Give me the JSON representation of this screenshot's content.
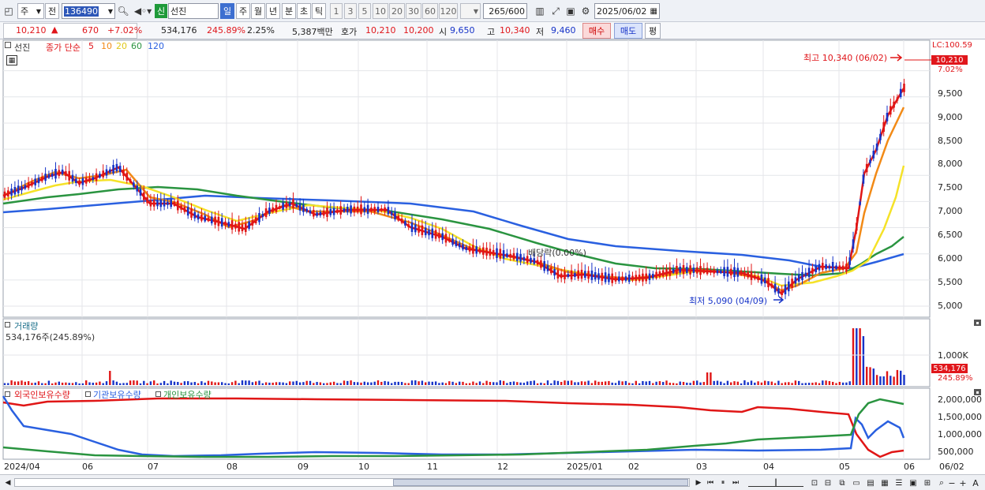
{
  "toolbar": {
    "period_select": "주",
    "prev_label": "전",
    "code": "136490",
    "sin_badge": "신",
    "stock_name": "선진",
    "timeframes": [
      "일",
      "주",
      "월",
      "년",
      "분",
      "초",
      "틱"
    ],
    "minute_options": [
      "1",
      "3",
      "5",
      "10",
      "20",
      "30",
      "60",
      "120"
    ],
    "count": "265",
    "count_total": "/600",
    "date": "2025/06/02"
  },
  "quote": {
    "price": "10,210",
    "change_arrow": "▲",
    "change": "670",
    "change_pct": "+7.02%",
    "volume": "534,176",
    "volume_ratio": "245.89%",
    "turnover": "2.25%",
    "amount": "5,387백만",
    "hoga_label": "호가",
    "ask": "10,210",
    "bid": "10,200",
    "open_label": "시",
    "open": "9,650",
    "high_label": "고",
    "high": "10,340",
    "low_label": "저",
    "low": "9,460",
    "buy_button": "매수",
    "sell_button": "매도",
    "eval_button": "평"
  },
  "price_panel": {
    "name_tag": "선진",
    "indicator_label": "종가 단순",
    "ma_periods": [
      "5",
      "10",
      "20",
      "60",
      "120"
    ],
    "ma_colors": [
      "#e01616",
      "#f28a16",
      "#f5e228",
      "#2a9440",
      "#2a60e0"
    ],
    "high_annotation": "최고 10,340 (06/02)",
    "low_annotation": "최저 5,090 (04/09)",
    "dividend_annotation": "배당락(0.00%)",
    "lc_label": "LC:100.59",
    "current_tag": "10,210",
    "current_pct": "7.02%",
    "y_ticks": [
      "9,500",
      "9,000",
      "8,500",
      "8,000",
      "7,500",
      "7,000",
      "6,500",
      "6,000",
      "5,500",
      "5,000"
    ]
  },
  "volume_panel": {
    "title": "거래량",
    "summary": "534,176주(245.89%)",
    "tick": "1,000K",
    "current_tag": "534,176",
    "current_pct": "245.89%"
  },
  "holdings_panel": {
    "series": [
      "외국인보유수량",
      "기관보유수량",
      "개인보유수량"
    ],
    "series_colors": [
      "#e01616",
      "#2a60e0",
      "#2a9440"
    ],
    "y_ticks": [
      "2,000,000",
      "1,500,000",
      "1,000,000",
      "500,000"
    ]
  },
  "x_axis": {
    "labels": [
      "2024/04",
      "06",
      "07",
      "08",
      "09",
      "10",
      "11",
      "12",
      "2025/01",
      "02",
      "03",
      "04",
      "05",
      "06"
    ],
    "end_date": "06/02"
  }
}
